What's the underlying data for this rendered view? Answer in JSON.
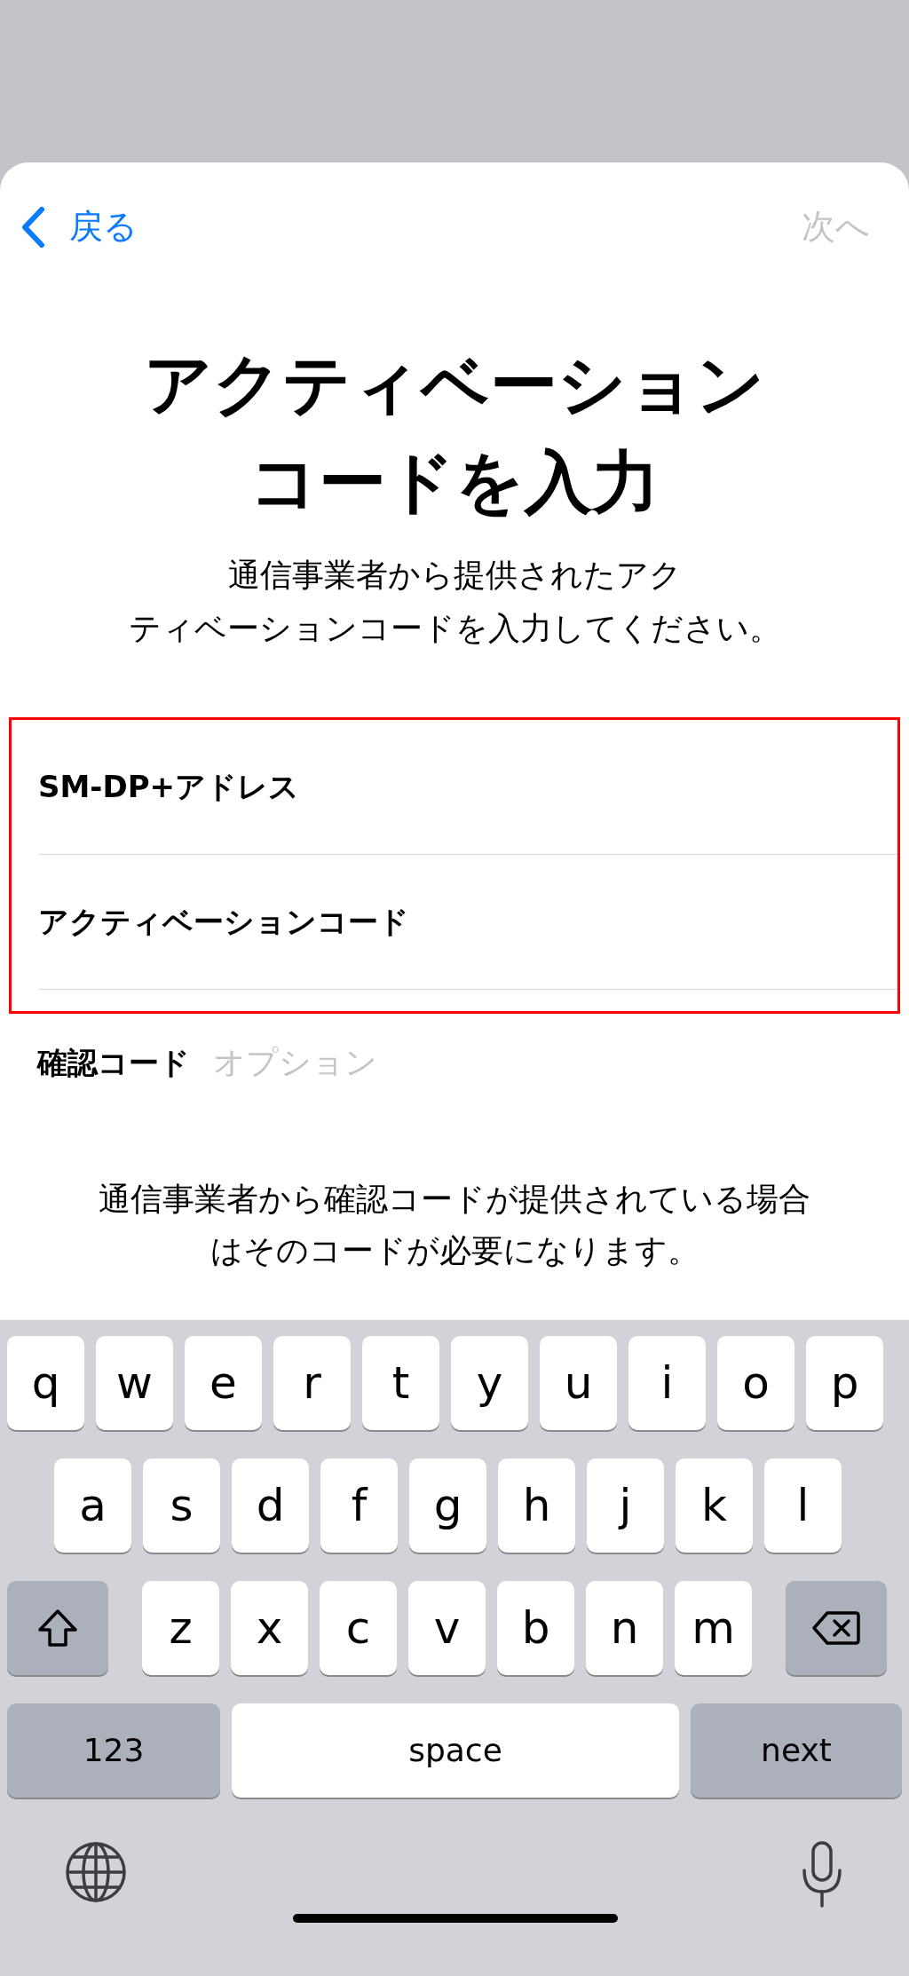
{
  "nav": {
    "back": "戻る",
    "next": {
      "label": "次へ",
      "disabled": true
    }
  },
  "title": [
    "アクティベーション",
    "コードを入力"
  ],
  "subtitle": [
    "通信事業者から提供されたアク",
    "ティベーションコードを入力してください。"
  ],
  "fields": [
    {
      "label": "SM-DP+アドレス",
      "highlighted": true
    },
    {
      "label": "アクティベーションコード",
      "highlighted": true
    },
    {
      "label": "確認コード",
      "placeholder": "オプション",
      "highlighted": false
    }
  ],
  "note": [
    "通信事業者から確認コードが提供されている場合",
    "はそのコードが必要になります。"
  ],
  "keyboard": {
    "rows": [
      {
        "keys": [
          {
            "kind": "letter",
            "label": "q"
          },
          {
            "kind": "letter",
            "label": "w"
          },
          {
            "kind": "letter",
            "label": "e"
          },
          {
            "kind": "letter",
            "label": "r"
          },
          {
            "kind": "letter",
            "label": "t"
          },
          {
            "kind": "letter",
            "label": "y"
          },
          {
            "kind": "letter",
            "label": "u"
          },
          {
            "kind": "letter",
            "label": "i"
          },
          {
            "kind": "letter",
            "label": "o"
          },
          {
            "kind": "letter",
            "label": "p"
          }
        ]
      },
      {
        "keys": [
          {
            "kind": "letter",
            "label": "a"
          },
          {
            "kind": "letter",
            "label": "s"
          },
          {
            "kind": "letter",
            "label": "d"
          },
          {
            "kind": "letter",
            "label": "f"
          },
          {
            "kind": "letter",
            "label": "g"
          },
          {
            "kind": "letter",
            "label": "h"
          },
          {
            "kind": "letter",
            "label": "j"
          },
          {
            "kind": "letter",
            "label": "k"
          },
          {
            "kind": "letter",
            "label": "l"
          }
        ]
      },
      {
        "keys": [
          {
            "kind": "shift"
          },
          {
            "kind": "letter",
            "label": "z"
          },
          {
            "kind": "letter",
            "label": "x"
          },
          {
            "kind": "letter",
            "label": "c"
          },
          {
            "kind": "letter",
            "label": "v"
          },
          {
            "kind": "letter",
            "label": "b"
          },
          {
            "kind": "letter",
            "label": "n"
          },
          {
            "kind": "letter",
            "label": "m"
          },
          {
            "kind": "backspace"
          }
        ]
      },
      {
        "keys": [
          {
            "kind": "mode",
            "label": "123"
          },
          {
            "kind": "space",
            "label": "space"
          },
          {
            "kind": "return",
            "label": "next"
          }
        ]
      }
    ]
  }
}
